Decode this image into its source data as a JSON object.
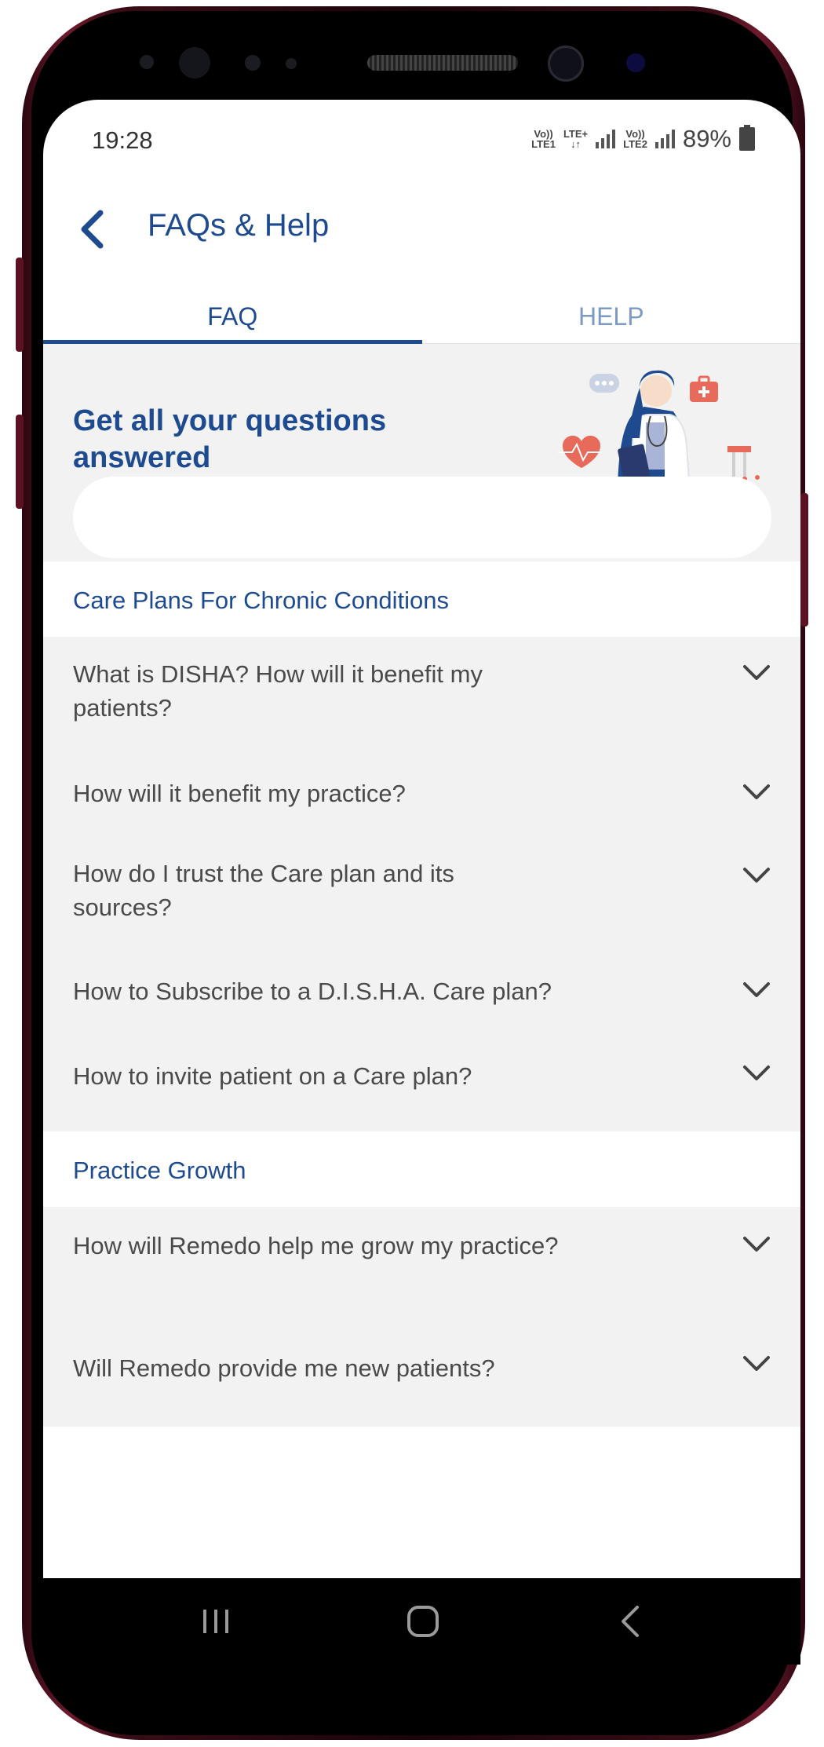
{
  "status_bar": {
    "time": "19:28",
    "sim1_top": "Vo))",
    "sim1_bottom": "LTE1",
    "lte_plus": "LTE+",
    "sim2_top": "Vo))",
    "sim2_bottom": "LTE2",
    "battery": "89%"
  },
  "header": {
    "title": "FAQs & Help",
    "back_icon": "chevron-left-icon"
  },
  "tabs": [
    {
      "label": "FAQ",
      "active": true
    },
    {
      "label": "HELP",
      "active": false
    }
  ],
  "banner": {
    "heading": "Get all your questions answered",
    "search_placeholder": ""
  },
  "sections": [
    {
      "title": "Care Plans For Chronic Conditions",
      "questions": [
        "What is DISHA? How will it benefit my patients?",
        "How will it benefit my practice?",
        "How do I trust the Care plan and its sources?",
        "How to Subscribe to a D.I.S.H.A. Care plan?",
        "How to invite patient on a Care plan?"
      ]
    },
    {
      "title": "Practice Growth",
      "questions": [
        "How will Remedo help me grow my practice?",
        "Will Remedo provide me new patients?"
      ]
    }
  ],
  "colors": {
    "brand_blue": "#1e4b8f",
    "tab_inactive": "#7d9ac4",
    "list_bg": "#f2f2f2",
    "text_gray": "#4a4a4a"
  }
}
